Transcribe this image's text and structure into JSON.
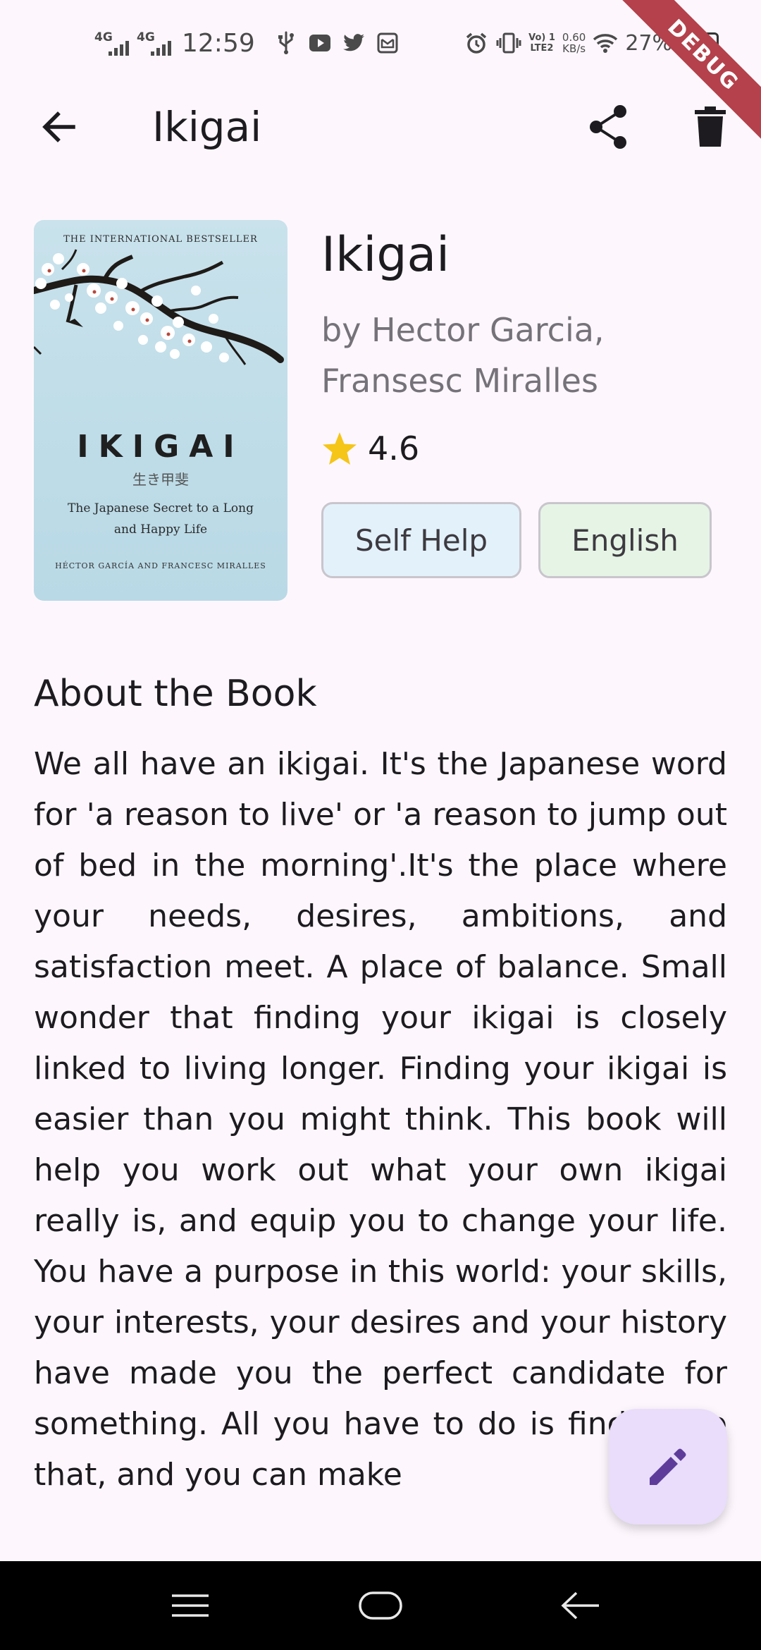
{
  "status_bar": {
    "time": "12:59",
    "signal_1_label": "4G",
    "signal_2_label": "4G",
    "volte_label_1": "Vo) 1",
    "volte_label_2": "LTE2",
    "net_speed_value": "0.60",
    "net_speed_unit": "KB/s",
    "battery_percent": "27%",
    "battery_level": 0.27,
    "icons": [
      "usb-icon",
      "youtube-icon",
      "twitter-icon",
      "mail-icon",
      "alarm-icon",
      "vibrate-icon",
      "wifi-icon",
      "battery-icon"
    ]
  },
  "debug_banner": "DEBUG",
  "app_bar": {
    "title": "Ikigai",
    "icons": [
      "back-arrow-icon",
      "share-icon",
      "delete-icon"
    ]
  },
  "cover": {
    "top_line": "THE INTERNATIONAL BESTSELLER",
    "title": "IKIGAI",
    "japanese": "生き甲斐",
    "subtitle": "The Japanese Secret to a Long and Happy Life",
    "authors": "HÉCTOR GARCÍA AND FRANCESC MIRALLES"
  },
  "book": {
    "title": "Ikigai",
    "author": "by Hector Garcia, Fransesc Miralles",
    "rating": "4.6",
    "genre": "Self Help",
    "language": "English"
  },
  "about": {
    "heading": "About the Book",
    "description": "We all have an ikigai. It's the Japanese word for 'a reason to live' or 'a reason to jump out of bed in the morning'.It's the place where your needs, desires, ambitions, and satisfaction meet. A place of balance. Small wonder that finding your ikigai is closely linked to living longer. Finding your ikigai is easier than you might think. This book will help you work out what your own ikigai really is, and equip you to change your life. You have a purpose in this world: your skills, your interests, your desires and your history have made you the perfect candidate for something. All you have to do is find it. Do that, and you can make"
  },
  "colors": {
    "background": "#fdf7fd",
    "primary": "#5e3d9a",
    "fab_background": "#e9ddfb",
    "star": "#f5c518",
    "genre_chip": "#e3f1fb",
    "language_chip": "#e6f4e6",
    "debug_ribbon": "#b4414b"
  },
  "fab": {
    "icon": "edit-pencil-icon"
  },
  "nav_bar": {
    "icons": [
      "menu-lines-icon",
      "home-pill-icon",
      "nav-back-icon"
    ]
  }
}
